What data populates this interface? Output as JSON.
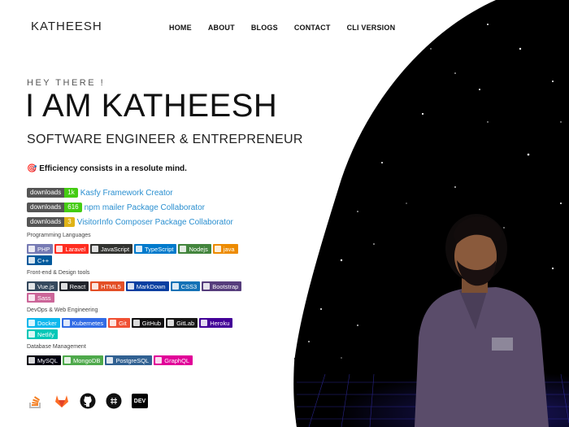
{
  "brand": "KATHEESH",
  "nav": [
    "HOME",
    "ABOUT",
    "BLOGS",
    "CONTACT",
    "CLI VERSION"
  ],
  "intro": {
    "greeting": "HEY THERE !",
    "name": "I AM KATHEESH",
    "role": "SOFTWARE ENGINEER & ENTREPRENEUR",
    "quote": "🎯 Efficiency consists in a resolute mind."
  },
  "downloads": [
    {
      "label": "downloads",
      "count": "1k",
      "color": "#4c1",
      "link": "Kasfy Framework Creator"
    },
    {
      "label": "downloads",
      "count": "616",
      "color": "#4c1",
      "link": "npm mailer Package Collaborator"
    },
    {
      "label": "downloads",
      "count": "3",
      "color": "#dfb317",
      "link": "VisitorInfo Composer Package Collaborator"
    }
  ],
  "sections": [
    {
      "title": "Programming Languages",
      "chips": [
        {
          "label": "PHP",
          "color": "#777bb4"
        },
        {
          "label": "Laravel",
          "color": "#ff2d20"
        },
        {
          "label": "JavaScript",
          "color": "#323330"
        },
        {
          "label": "TypeScript",
          "color": "#007acc"
        },
        {
          "label": "Nodejs",
          "color": "#43853d"
        },
        {
          "label": "java",
          "color": "#ed8b00"
        },
        {
          "label": "C++",
          "color": "#00599c"
        }
      ]
    },
    {
      "title": "Front-end & Design tools",
      "chips": [
        {
          "label": "Vue.js",
          "color": "#35495e"
        },
        {
          "label": "React",
          "color": "#20232a"
        },
        {
          "label": "HTML5",
          "color": "#e34f26"
        },
        {
          "label": "MarkDown",
          "color": "#083fa1"
        },
        {
          "label": "CSS3",
          "color": "#1572b6"
        },
        {
          "label": "Bootstrap",
          "color": "#563d7c"
        },
        {
          "label": "Sass",
          "color": "#cc6699"
        }
      ]
    },
    {
      "title": "DevOps & Web Engineering",
      "chips": [
        {
          "label": "Docker",
          "color": "#0db7ed"
        },
        {
          "label": "Kubernetes",
          "color": "#326ce5"
        },
        {
          "label": "Git",
          "color": "#f05033"
        },
        {
          "label": "GitHub",
          "color": "#121011"
        },
        {
          "label": "GitLab",
          "color": "#181717"
        },
        {
          "label": "Heroku",
          "color": "#430098"
        },
        {
          "label": "Netlify",
          "color": "#00c7b7"
        }
      ]
    },
    {
      "title": "Database Management",
      "chips": [
        {
          "label": "MySQL",
          "color": "#00000f"
        },
        {
          "label": "MongoDB",
          "color": "#4ea94b"
        },
        {
          "label": "PostgreSQL",
          "color": "#316192"
        },
        {
          "label": "GraphQL",
          "color": "#e10098"
        }
      ]
    }
  ],
  "social_icons": [
    "stackoverflow-icon",
    "gitlab-icon",
    "github-icon",
    "hashnode-icon",
    "dev-icon"
  ],
  "dev_text": "DEV"
}
